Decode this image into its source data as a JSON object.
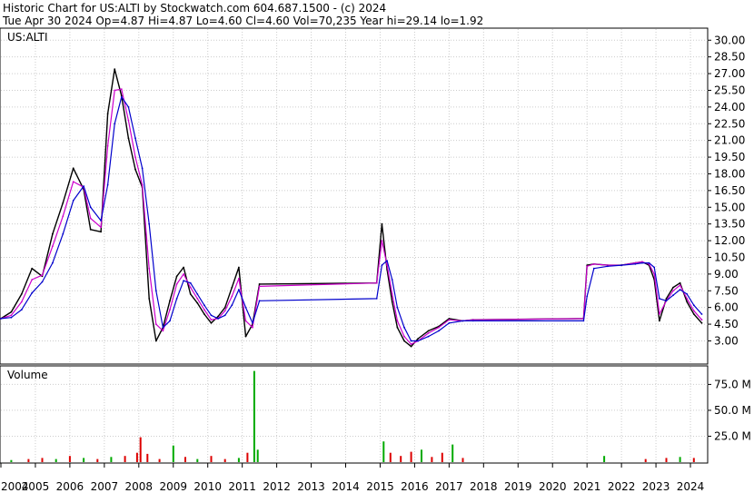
{
  "header": {
    "line1": "Historic Chart for US:ALTI by Stockwatch.com 604.687.1500 - (c) 2024",
    "line2": "Tue Apr 30 2024  Op=4.87  Hi=4.87  Lo=4.60  Cl=4.60  Vol=70,235  Year hi=29.14  lo=1.92"
  },
  "chart_data": [
    {
      "type": "line",
      "label": "US:ALTI",
      "ylim": [
        1.0,
        31.0
      ],
      "yticks": [
        "30.00",
        "28.50",
        "27.00",
        "25.50",
        "24.00",
        "22.50",
        "21.00",
        "19.50",
        "18.00",
        "16.50",
        "15.00",
        "13.50",
        "12.00",
        "10.50",
        "9.00",
        "7.50",
        "6.00",
        "4.50",
        "3.00"
      ],
      "ytick_values": [
        30,
        28.5,
        27,
        25.5,
        24,
        22.5,
        21,
        19.5,
        18,
        16.5,
        15,
        13.5,
        12,
        10.5,
        9,
        7.5,
        6,
        4.5,
        3
      ],
      "xticks": [
        "2004",
        "2005",
        "2006",
        "2007",
        "2008",
        "2009",
        "2010",
        "2011",
        "2012",
        "2013",
        "2014",
        "2015",
        "2016",
        "2017",
        "2018",
        "2019",
        "2020",
        "2021",
        "2022",
        "2023",
        "2024"
      ],
      "x": [
        2004.0,
        2004.3,
        2004.6,
        2004.9,
        2005.2,
        2005.5,
        2005.8,
        2006.1,
        2006.4,
        2006.6,
        2006.9,
        2007.1,
        2007.3,
        2007.5,
        2007.7,
        2007.9,
        2008.1,
        2008.3,
        2008.5,
        2008.7,
        2008.9,
        2009.1,
        2009.3,
        2009.5,
        2009.7,
        2009.9,
        2010.1,
        2010.3,
        2010.5,
        2010.7,
        2010.9,
        2011.1,
        2011.3,
        2011.5,
        2014.9,
        2015.05,
        2015.2,
        2015.35,
        2015.5,
        2015.7,
        2015.9,
        2016.1,
        2016.4,
        2016.7,
        2017.0,
        2017.4,
        2017.7,
        2020.9,
        2021.0,
        2021.2,
        2021.6,
        2022.0,
        2022.4,
        2022.6,
        2022.8,
        2022.95,
        2023.1,
        2023.3,
        2023.5,
        2023.7,
        2023.9,
        2024.1,
        2024.33
      ],
      "series": [
        {
          "name": "",
          "color": "#000000",
          "values": [
            5.0,
            5.6,
            7.2,
            9.5,
            8.8,
            12.6,
            15.4,
            18.5,
            16.6,
            13.0,
            12.8,
            23.4,
            27.4,
            25.0,
            21.2,
            18.4,
            16.8,
            6.8,
            3.0,
            4.2,
            6.6,
            8.8,
            9.6,
            7.2,
            6.4,
            5.4,
            4.6,
            5.2,
            6.0,
            7.8,
            9.6,
            3.4,
            4.5,
            8.1,
            8.2,
            13.5,
            9.4,
            6.5,
            4.2,
            3.0,
            2.5,
            3.2,
            3.9,
            4.3,
            5.0,
            4.8,
            4.9,
            5.0,
            9.8,
            9.9,
            9.8,
            9.8,
            10.0,
            10.1,
            9.8,
            8.5,
            4.8,
            6.8,
            7.8,
            8.2,
            6.5,
            5.4,
            4.6
          ]
        },
        {
          "name": "",
          "color": "#cc00cc",
          "values": [
            5.0,
            5.3,
            6.5,
            8.5,
            8.9,
            11.5,
            14.2,
            17.3,
            16.8,
            14.0,
            13.2,
            20.5,
            25.5,
            25.6,
            22.8,
            19.5,
            17.0,
            9.5,
            4.5,
            3.9,
            5.8,
            8.1,
            9.0,
            7.8,
            6.8,
            5.8,
            4.9,
            5.0,
            5.7,
            7.0,
            8.6,
            4.8,
            4.2,
            7.9,
            8.2,
            12.0,
            9.8,
            7.2,
            4.8,
            3.4,
            2.7,
            3.0,
            3.7,
            4.2,
            4.9,
            4.8,
            4.9,
            5.0,
            9.7,
            9.9,
            9.8,
            9.8,
            10.0,
            10.1,
            9.9,
            9.0,
            5.4,
            6.6,
            7.5,
            8.0,
            6.8,
            5.7,
            4.9
          ]
        },
        {
          "name": "",
          "color": "#0000cc",
          "values": [
            5.0,
            5.1,
            5.8,
            7.3,
            8.3,
            10.0,
            12.6,
            15.6,
            16.9,
            15.0,
            13.8,
            17.0,
            22.5,
            24.9,
            24.0,
            21.2,
            18.5,
            13.5,
            7.5,
            4.2,
            4.8,
            6.8,
            8.4,
            8.2,
            7.2,
            6.2,
            5.3,
            5.0,
            5.3,
            6.2,
            7.6,
            6.0,
            4.6,
            6.6,
            6.8,
            9.8,
            10.2,
            8.5,
            6.0,
            4.2,
            3.0,
            3.0,
            3.4,
            3.9,
            4.6,
            4.8,
            4.8,
            4.8,
            7.0,
            9.5,
            9.7,
            9.8,
            9.9,
            10.0,
            10.0,
            9.6,
            6.8,
            6.6,
            7.1,
            7.6,
            7.2,
            6.2,
            5.4
          ]
        }
      ]
    },
    {
      "type": "bar",
      "label": "Volume",
      "ylim": [
        0,
        92
      ],
      "ytick_labels": [
        "75.0 M",
        "50.0 M",
        "25.0 M"
      ],
      "ytick_values": [
        75,
        50,
        25
      ],
      "bar_colors": {
        "up": "#00aa00",
        "down": "#dd0000"
      },
      "x": [
        2004.3,
        2004.8,
        2005.2,
        2005.6,
        2006.0,
        2006.4,
        2006.8,
        2007.2,
        2007.6,
        2007.95,
        2008.05,
        2008.25,
        2008.6,
        2009.0,
        2009.35,
        2009.7,
        2010.1,
        2010.5,
        2010.9,
        2011.15,
        2011.35,
        2011.45,
        2015.1,
        2015.3,
        2015.6,
        2015.9,
        2016.2,
        2016.5,
        2016.8,
        2017.1,
        2017.4,
        2021.5,
        2022.7,
        2023.3,
        2023.7,
        2024.1
      ],
      "values": [
        2,
        3,
        4,
        3,
        6,
        4,
        3,
        5,
        6,
        9,
        24,
        8,
        3,
        16,
        5,
        3,
        6,
        3,
        4,
        9,
        88,
        12,
        20,
        9,
        6,
        10,
        12,
        5,
        9,
        17,
        4,
        6,
        3,
        4,
        5,
        4
      ],
      "directions": [
        "up",
        "down",
        "down",
        "up",
        "down",
        "up",
        "down",
        "up",
        "down",
        "down",
        "down",
        "down",
        "down",
        "up",
        "down",
        "up",
        "down",
        "down",
        "up",
        "down",
        "up",
        "up",
        "up",
        "down",
        "down",
        "down",
        "up",
        "down",
        "down",
        "up",
        "down",
        "up",
        "down",
        "down",
        "up",
        "down"
      ]
    }
  ]
}
